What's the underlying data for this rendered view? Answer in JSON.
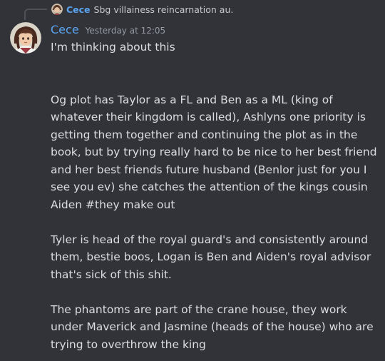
{
  "reply": {
    "author": "Cece",
    "text": "Sbg villainess reincarnation au."
  },
  "message": {
    "author": "Cece",
    "timestamp": "Yesterday at 12:05",
    "author_color": "#5aa3f0",
    "paragraphs": [
      "I'm thinking about this",
      "Og plot has Taylor as a FL and Ben as a ML (king of whatever their kingdom is called), Ashlyns one priority is getting them together and continuing the plot as in the book, but by trying really hard to be nice to her best friend and her best friends future husband (Benlor just for you I see you ev) she catches the attention of the kings cousin Aiden #they make out",
      "Tyler is head of the royal guard's and consistently around them, bestie boos, Logan is Ben and Aiden's royal advisor that's sick of this shit.",
      "The phantoms are part of the crane house, they work under Maverick and Jasmine (heads of the house) who are trying to overthrow the king"
    ]
  }
}
